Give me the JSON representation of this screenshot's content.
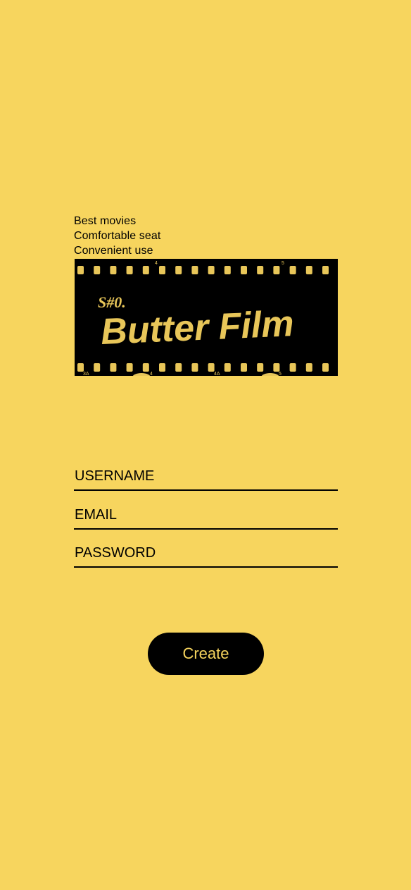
{
  "taglines": [
    "Best movies",
    "Comfortable seat",
    "Convenient use"
  ],
  "logo": {
    "kicker": "S#0.",
    "title": "Butter Film",
    "frame_numbers_top": [
      "4",
      "5"
    ],
    "frame_numbers_bottom": [
      "3A",
      "4",
      "4A",
      "5"
    ],
    "icon": "film-strip-logo",
    "colors": {
      "strip": "#000000",
      "text": "#E8C659"
    }
  },
  "form": {
    "username_placeholder": "USERNAME",
    "email_placeholder": "EMAIL",
    "password_placeholder": "PASSWORD",
    "username_value": "",
    "email_value": "",
    "password_value": ""
  },
  "create_button_label": "Create",
  "colors": {
    "background": "#F7D55E",
    "button": "#000000",
    "button_text": "#F7D55E"
  }
}
